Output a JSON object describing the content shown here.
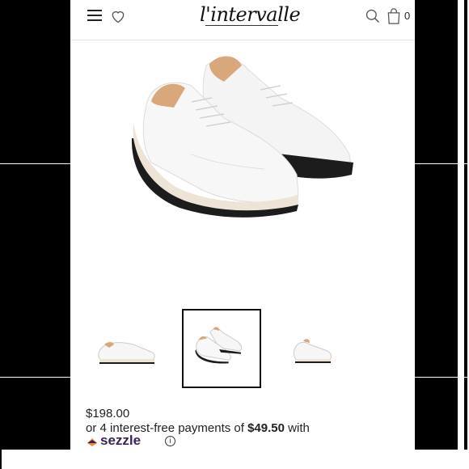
{
  "header": {
    "logo_text": "l'intervalle",
    "cart_count": "0",
    "icons": [
      "menu-icon",
      "heart-icon",
      "search-icon",
      "bag-icon"
    ]
  },
  "product": {
    "price": "$198.00",
    "installments_prefix": "or 4 interest-free payments of ",
    "installment_amount": "$49.50",
    "installments_suffix": " with",
    "sezzle_label": "sezzle",
    "info_glyph": "i"
  },
  "gallery": {
    "selected_index": 2,
    "thumbnail_count": 3
  },
  "colors": {
    "sole": "#ede3d6",
    "shoe": "#f6f6f6",
    "tongue": "#d9a77c",
    "outsole": "#1c1c1c",
    "sezzle": "#392558"
  }
}
